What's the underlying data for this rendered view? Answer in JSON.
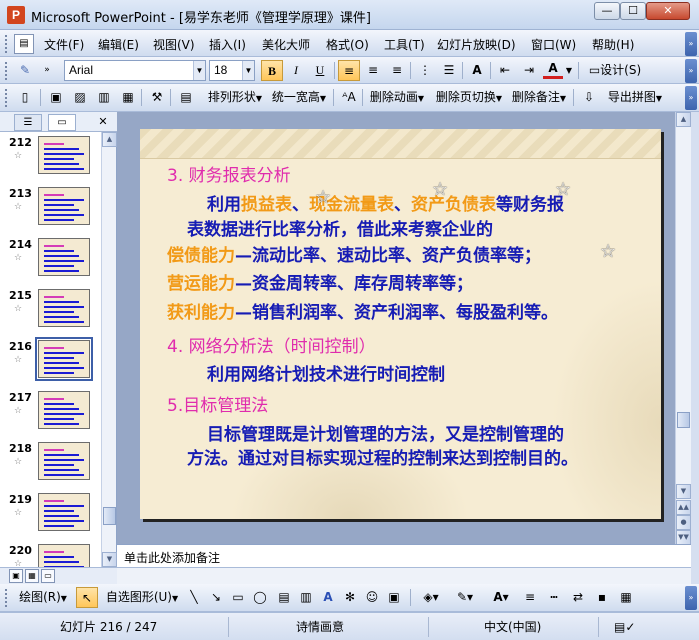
{
  "window": {
    "app_icon": "P",
    "title": "Microsoft PowerPoint - [易学东老师《管理学原理》课件]",
    "minimize": "—",
    "maximize": "☐",
    "close": "✕"
  },
  "menu": {
    "items": [
      "文件(F)",
      "编辑(E)",
      "视图(V)",
      "插入(I)",
      "美化大师",
      "格式(O)",
      "工具(T)",
      "幻灯片放映(D)",
      "窗口(W)",
      "帮助(H)"
    ]
  },
  "format_toolbar": {
    "font_name": "Arial",
    "font_size": "18",
    "bold": "B",
    "italic": "I",
    "underline": "U",
    "design": "设计(S)"
  },
  "draw_toolbar_top": {
    "arrange": "排列形状",
    "widen": "统一宽高",
    "delete_animation": "删除动画",
    "delete_transition": "删除页切换",
    "delete_notes": "删除备注",
    "export": "导出拼图"
  },
  "slides_pane": {
    "thumbnails": [
      {
        "num": "212",
        "star": "☆"
      },
      {
        "num": "213",
        "star": "☆"
      },
      {
        "num": "214",
        "star": "☆"
      },
      {
        "num": "215",
        "star": "☆"
      },
      {
        "num": "216",
        "star": "☆"
      },
      {
        "num": "217",
        "star": "☆"
      },
      {
        "num": "218",
        "star": "☆"
      },
      {
        "num": "219",
        "star": "☆"
      },
      {
        "num": "220",
        "star": "☆"
      }
    ],
    "selected": "216",
    "close": "✕"
  },
  "slide": {
    "h3": "3.  财务报表分析",
    "p1_pre": "利用",
    "p1_o1": "损益表",
    "p1_sep1": "、",
    "p1_o2": "现金流量表",
    "p1_sep2": "、",
    "p1_o3": "资产负债表",
    "p1_post": "等财务报",
    "p1_line2": "表数据进行比率分析，借此来考察企业的",
    "l1_o": "偿债能力",
    "l1_rest": "—流动比率、速动比率、资产负债率等；",
    "l2_o": "营运能力",
    "l2_rest": "—资金周转率、库存周转率等；",
    "l3_o": "获利能力",
    "l3_rest": "—销售利润率、资产利润率、每股盈利等。",
    "h4": "4.  网络分析法（时间控制）",
    "p4": "利用网络计划技术进行时间控制",
    "h5": "5.目标管理法",
    "p5_line1": "目标管理既是计划管理的方法，又是控制管理的",
    "p5_line2": "方法。通过对目标实现过程的控制来达到控制目的。",
    "star": "☆"
  },
  "notes": {
    "placeholder": "单击此处添加备注"
  },
  "draw_toolbar_bottom": {
    "draw": "绘图(R)",
    "autoshape": "自选图形(U)"
  },
  "status_bar": {
    "slide_pos": "幻灯片 216 / 247",
    "design_name": "诗情画意",
    "language": "中文(中国)"
  },
  "colors": {
    "heading": "#e02cad",
    "body": "#161cb4",
    "highlight": "#f29a17",
    "slide_bg": "#f6ecd3"
  }
}
